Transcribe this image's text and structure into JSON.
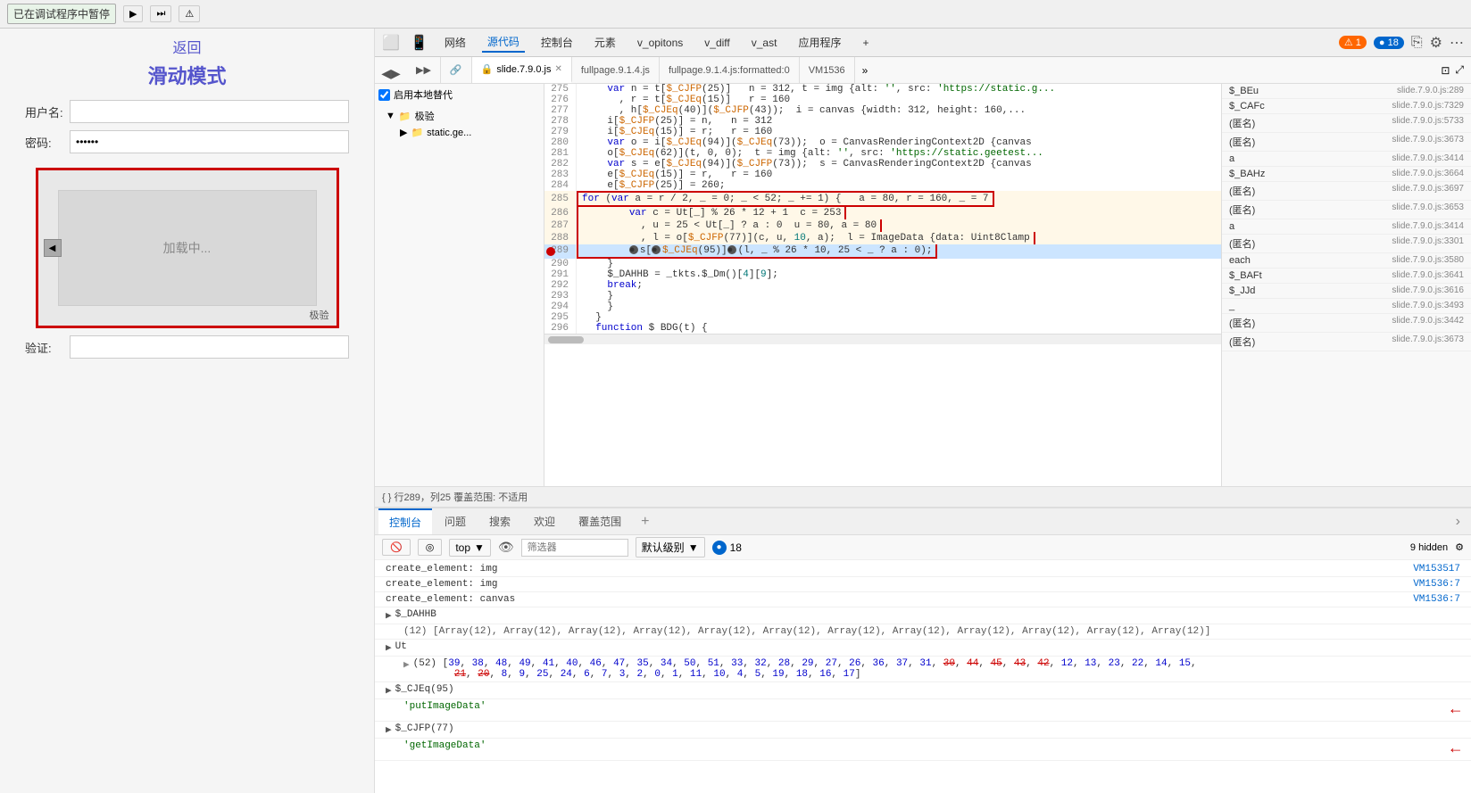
{
  "topbar": {
    "status": "已在调试程序中暂停",
    "btn_play": "▶",
    "btn_step": "⏭"
  },
  "left": {
    "back": "返回",
    "title": "滑动模式",
    "username_label": "用户名:",
    "password_label": "密码:",
    "verify_label": "验证:",
    "captcha_loading": "加载中...",
    "captcha_brand": "极验"
  },
  "devtools": {
    "nav_tabs": [
      "网络",
      "源代码",
      "控制台",
      "元素",
      "v_opitons",
      "v_diff",
      "v_ast",
      "应用程序"
    ],
    "active_nav": "源代码",
    "badge_orange_count": "1",
    "badge_blue_count": "18",
    "file_tabs": [
      {
        "label": "slide.7.9.0.js",
        "active": true,
        "closable": true
      },
      {
        "label": "fullpage.9.1.4.js",
        "active": false
      },
      {
        "label": "fullpage.9.1.4.js:formatted:0",
        "active": false
      },
      {
        "label": "VM1536",
        "active": false
      }
    ],
    "status_bar": "{ } 行289，列25   覆盖范围: 不适用",
    "coverage_checkbox": "启用本地替代",
    "file_tree": {
      "folder": "极验",
      "subfolder": "static.ge..."
    },
    "code_lines": [
      {
        "num": "275",
        "content": "    var n = t[$_CJFP(25)]   n = 312, t = img {alt: '', src: 'https://static.g...",
        "highlight": false,
        "bp": false
      },
      {
        "num": "276",
        "content": "      , r = t[$_CJEq(15)]   r = 160",
        "highlight": false,
        "bp": false
      },
      {
        "num": "277",
        "content": "      , h[$_CJEq(40)]($_CJFP(43));  i = canvas {width: 312, height: 160,...",
        "highlight": false,
        "bp": false
      },
      {
        "num": "278",
        "content": "    i[$_CJFP(25)] = n,   n = 312",
        "highlight": false,
        "bp": false
      },
      {
        "num": "279",
        "content": "    i[$_CJEq(15)] = r;   r = 160",
        "highlight": false,
        "bp": false
      },
      {
        "num": "280",
        "content": "    var o = i[$_CJEq(94)]($_CJEq(73));  o = CanvasRenderingContext2D {canvas",
        "highlight": false,
        "bp": false
      },
      {
        "num": "281",
        "content": "    o[$_CJEq(62)](t, 0, 0);  t = img {alt: '', src: 'https://static.geetest...",
        "highlight": false,
        "bp": false
      },
      {
        "num": "282",
        "content": "    var s = e[$_CJEq(94)]($_CJFP(73));  s = CanvasRenderingContext2D {canvas",
        "highlight": false,
        "bp": false
      },
      {
        "num": "283",
        "content": "    e[$_CJEq(15)] = r,   r = 160",
        "highlight": false,
        "bp": false
      },
      {
        "num": "284",
        "content": "    e[$_CJFP(25)] = 260;",
        "highlight": false,
        "bp": false
      },
      {
        "num": "285",
        "content": "    for (var a = r / 2, _ = 0; _ < 52; _ += 1) {   a = 80, r = 160, _ = 7",
        "highlight": true,
        "bp": false
      },
      {
        "num": "286",
        "content": "        var c = Ut[_] % 26 * 12 + 1  c = 253",
        "highlight": true,
        "bp": false
      },
      {
        "num": "287",
        "content": "          , u = 25 < Ut[_] ? a : 0  u = 80, a = 80",
        "highlight": true,
        "bp": false
      },
      {
        "num": "288",
        "content": "          , l = o[$_CJFP(77)](c, u, 10, a);  l = ImageData {data: Uint8Clamp",
        "highlight": true,
        "bp": false
      },
      {
        "num": "289",
        "content": "        ●s[●$_CJEq(95)]●(l, _ % 26 * 10, 25 < _ ? a : 0);",
        "highlight": true,
        "bp": true,
        "is_current": true
      },
      {
        "num": "290",
        "content": "    }",
        "highlight": false,
        "bp": false
      },
      {
        "num": "291",
        "content": "    $_DAHHB = _tkts.$_Dm()[4][9];",
        "highlight": false,
        "bp": false
      },
      {
        "num": "292",
        "content": "    break;",
        "highlight": false,
        "bp": false
      },
      {
        "num": "293",
        "content": "    }",
        "highlight": false,
        "bp": false
      },
      {
        "num": "294",
        "content": "    }",
        "highlight": false,
        "bp": false
      },
      {
        "num": "295",
        "content": "  }",
        "highlight": false,
        "bp": false
      },
      {
        "num": "296",
        "content": "  function $ BDG(t) {",
        "highlight": false,
        "bp": false
      }
    ],
    "variables": [
      {
        "name": "$_BEu",
        "file": "slide.7.9.0.js:289"
      },
      {
        "name": "$_CAFc",
        "file": "slide.7.9.0.js:7329"
      },
      {
        "name": "(匿名)",
        "file": "slide.7.9.0.js:5733"
      },
      {
        "name": "(匿名)",
        "file": "slide.7.9.0.js:3673"
      },
      {
        "name": "a",
        "file": "slide.7.9.0.js:3414"
      },
      {
        "name": "$_BAHz",
        "file": "slide.7.9.0.js:3664"
      },
      {
        "name": "(匿名)",
        "file": "slide.7.9.0.js:3697"
      },
      {
        "name": "(匿名)",
        "file": "slide.7.9.0.js:3653"
      },
      {
        "name": "a",
        "file": "slide.7.9.0.js:3414"
      },
      {
        "name": "(匿名)",
        "file": "slide.7.9.0.js:3301"
      },
      {
        "name": "each",
        "file": "slide.7.9.0.js:3580"
      },
      {
        "name": "$_BAFt",
        "file": "slide.7.9.0.js:3641"
      },
      {
        "name": "$_JJd",
        "file": "slide.7.9.0.js:3616"
      },
      {
        "name": "_",
        "file": "slide.7.9.0.js:3493"
      },
      {
        "name": "(匿名)",
        "file": "slide.7.9.0.js:3442"
      },
      {
        "name": "(匿名)",
        "file": "slide.7.9.0.js:3673"
      }
    ],
    "console": {
      "tabs": [
        "控制台",
        "问题",
        "搜索",
        "欢迎",
        "覆盖范围"
      ],
      "active_tab": "控制台",
      "toolbar_top_label": "top",
      "filter_placeholder": "筛选器",
      "level_label": "默认级别",
      "badge_blue": "18",
      "hidden_count": "9 hidden",
      "lines": [
        {
          "text": "create_element: img",
          "src": "VM153517",
          "expand": false,
          "arrow": false
        },
        {
          "text": "create_element: img",
          "src": "VM1536:7",
          "expand": false,
          "arrow": false
        },
        {
          "text": "create_element: canvas",
          "src": "VM1536:7",
          "expand": false,
          "arrow": false
        },
        {
          "text": "$_DAHHB",
          "src": "",
          "expand": true,
          "arrow": false
        },
        {
          "text": "(12) [Array(12), Array(12), Array(12), Array(12), Array(12), Array(12), Array(12), Array(12), Array(12), Array(12), Array(12), Array(12)]",
          "src": "",
          "expand": false,
          "arrow": false,
          "indent": true
        },
        {
          "text": "Ut",
          "src": "",
          "expand": true,
          "arrow": false
        },
        {
          "text": "(52) [39, 38, 48, 49, 41, 40, 46, 47, 35, 34, 50, 51, 33, 32, 28, 29, 27, 26, 36, 37, 31, 30, 44, 45, 43, 42, 12, 13, 23, 22, 14, 15, 21, 20, 8, 9, 25, 24, 6, 7, 3, 2, 0, 1, 11, 10, 4, 5, 19, 18, 16, 17]",
          "src": "",
          "expand": false,
          "arrow": false,
          "indent": true,
          "has_strikethrough": true
        },
        {
          "text": "$_CJEq(95)",
          "src": "",
          "expand": true,
          "arrow": false
        },
        {
          "text": "'putImageData'",
          "src": "",
          "expand": false,
          "arrow": true
        },
        {
          "text": "$_CJFP(77)",
          "src": "",
          "expand": true,
          "arrow": false
        },
        {
          "text": "'getImageData'",
          "src": "",
          "expand": false,
          "arrow": true
        }
      ]
    }
  }
}
